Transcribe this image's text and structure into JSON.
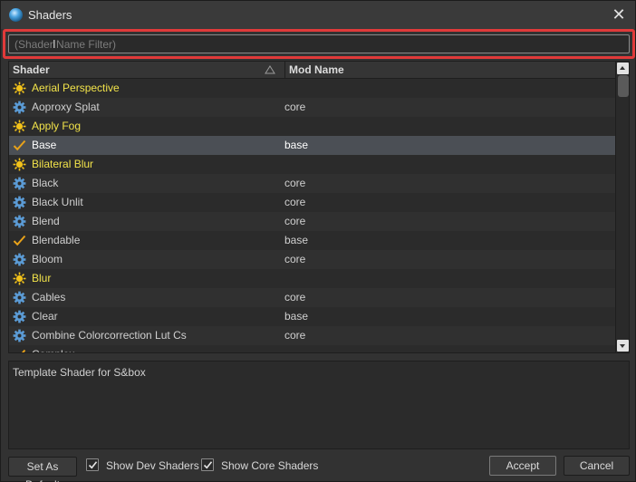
{
  "window": {
    "title": "Shaders"
  },
  "filter": {
    "placeholder": "(Shader Name Filter)",
    "value": ""
  },
  "table": {
    "columns": {
      "shader": "Shader",
      "mod": "Mod Name"
    },
    "rows": [
      {
        "name": "Aerial Perspective",
        "mod": "",
        "icon": "sun-icon",
        "style": "yellow",
        "selected": false
      },
      {
        "name": "Aoproxy Splat",
        "mod": "core",
        "icon": "gear-icon",
        "style": "normal",
        "selected": false
      },
      {
        "name": "Apply Fog",
        "mod": "",
        "icon": "sun-icon",
        "style": "yellow",
        "selected": false
      },
      {
        "name": "Base",
        "mod": "base",
        "icon": "checkmark-icon",
        "style": "bold",
        "selected": true
      },
      {
        "name": "Bilateral Blur",
        "mod": "",
        "icon": "sun-icon",
        "style": "yellow",
        "selected": false
      },
      {
        "name": "Black",
        "mod": "core",
        "icon": "gear-icon",
        "style": "normal",
        "selected": false
      },
      {
        "name": "Black Unlit",
        "mod": "core",
        "icon": "gear-icon",
        "style": "normal",
        "selected": false
      },
      {
        "name": "Blend",
        "mod": "core",
        "icon": "gear-icon",
        "style": "normal",
        "selected": false
      },
      {
        "name": "Blendable",
        "mod": "base",
        "icon": "checkmark-icon",
        "style": "normal",
        "selected": false
      },
      {
        "name": "Bloom",
        "mod": "core",
        "icon": "gear-icon",
        "style": "normal",
        "selected": false
      },
      {
        "name": "Blur",
        "mod": "",
        "icon": "sun-icon",
        "style": "yellow",
        "selected": false
      },
      {
        "name": "Cables",
        "mod": "core",
        "icon": "gear-icon",
        "style": "normal",
        "selected": false
      },
      {
        "name": "Clear",
        "mod": "base",
        "icon": "gear-icon",
        "style": "normal",
        "selected": false
      },
      {
        "name": "Combine Colorcorrection Lut Cs",
        "mod": "core",
        "icon": "gear-icon",
        "style": "normal",
        "selected": false
      },
      {
        "name": "Complex",
        "mod": "",
        "icon": "checkmark-icon",
        "style": "normal",
        "selected": false
      }
    ]
  },
  "description": "Template Shader for S&box",
  "footer": {
    "set_default_label": "Set As Default",
    "show_dev_label": "Show Dev Shaders",
    "show_dev_checked": true,
    "show_core_label": "Show Core Shaders",
    "show_core_checked": true,
    "accept_label": "Accept",
    "cancel_label": "Cancel"
  },
  "colors": {
    "highlight": "#e03a3a",
    "sun": "#f2c21a",
    "gear": "#5b9bd5",
    "check": "#e8a21a",
    "yellow_text": "#f2e34a"
  }
}
